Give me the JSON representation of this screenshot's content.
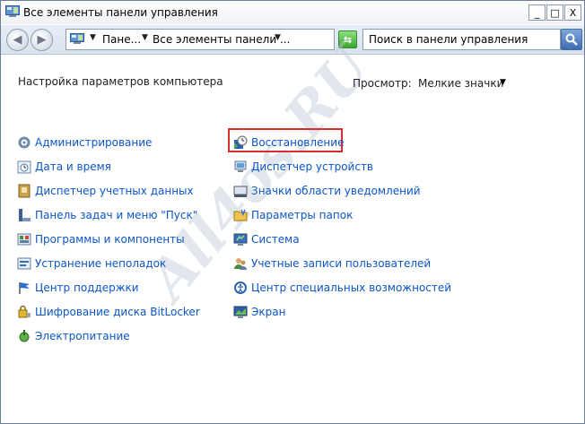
{
  "window": {
    "title": "Все элементы панели управления"
  },
  "controls": {
    "minimize": "_",
    "maximize": "□",
    "close": "X"
  },
  "navbar": {
    "crumbs": [
      "Пане...",
      "Все элементы панели ..."
    ],
    "search_placeholder": "Поиск в панели управления"
  },
  "content": {
    "heading": "Настройка параметров компьютера",
    "view_label": "Просмотр:",
    "view_value": "Мелкие значки",
    "left_items": [
      {
        "label": "Администрирование",
        "icon": "admin-tools-icon"
      },
      {
        "label": "Дата и время",
        "icon": "date-time-icon"
      },
      {
        "label": "Диспетчер учетных данных",
        "icon": "credential-manager-icon"
      },
      {
        "label": "Панель задач и меню \"Пуск\"",
        "icon": "taskbar-icon"
      },
      {
        "label": "Программы и компоненты",
        "icon": "programs-icon"
      },
      {
        "label": "Устранение неполадок",
        "icon": "troubleshooting-icon"
      },
      {
        "label": "Центр поддержки",
        "icon": "action-center-flag-icon"
      },
      {
        "label": "Шифрование диска BitLocker",
        "icon": "bitlocker-icon"
      },
      {
        "label": "Электропитание",
        "icon": "power-options-icon"
      }
    ],
    "right_items": [
      {
        "label": "Восстановление",
        "icon": "recovery-icon"
      },
      {
        "label": "Диспетчер устройств",
        "icon": "device-manager-icon"
      },
      {
        "label": "Значки области уведомлений",
        "icon": "notification-icons-icon"
      },
      {
        "label": "Параметры папок",
        "icon": "folder-options-icon"
      },
      {
        "label": "Система",
        "icon": "system-icon"
      },
      {
        "label": "Учетные записи пользователей",
        "icon": "user-accounts-icon"
      },
      {
        "label": "Центр специальных возможностей",
        "icon": "ease-of-access-icon"
      },
      {
        "label": "Экран",
        "icon": "display-icon"
      }
    ]
  },
  "watermark": "All4os.RU",
  "colors": {
    "link": "#0b56c7",
    "highlight": "#d62d2d"
  }
}
